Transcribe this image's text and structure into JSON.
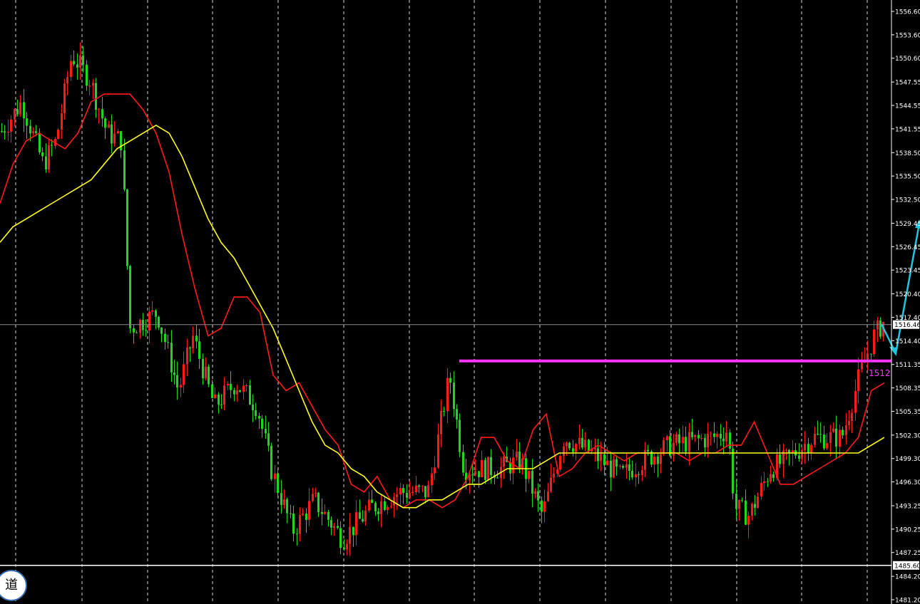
{
  "chart_data": {
    "type": "candlestick",
    "title": "",
    "y_axis": {
      "ticks": [
        "1556.60",
        "1553.60",
        "1550.60",
        "1547.55",
        "1544.55",
        "1541.55",
        "1538.50",
        "1535.50",
        "1532.50",
        "1529.45",
        "1526.45",
        "1523.45",
        "1520.40",
        "1517.40",
        "1514.40",
        "1511.35",
        "1508.35",
        "1505.35",
        "1502.30",
        "1499.30",
        "1496.30",
        "1493.25",
        "1490.25",
        "1487.25",
        "1484.20",
        "1481.20"
      ],
      "ylim": [
        1481.2,
        1557.7
      ],
      "position": "right"
    },
    "grid": {
      "vertical_dashed": true,
      "horizontal": false
    },
    "current_price": "1516.46",
    "support_line": {
      "value": 1485.6,
      "label": "1485.60"
    },
    "resistance_line": {
      "value": 1511.8,
      "label": "1512",
      "color": "#ff33ff"
    },
    "projection_arrow_color": "#22c5e0",
    "candle_colors": {
      "up": "#ff1a1a",
      "down": "#1fd61f"
    },
    "series": [
      {
        "type": "line",
        "color": "#ff1a1a",
        "values": [
          1532,
          1537,
          1540,
          1541,
          1540,
          1539,
          1541,
          1545,
          1546,
          1546,
          1546,
          1544,
          1541,
          1536,
          1528,
          1521,
          1515,
          1516,
          1520,
          1520,
          1518,
          1510,
          1508,
          1509,
          1506,
          1503,
          1501,
          1496,
          1495,
          1497,
          1494,
          1493,
          1494,
          1494,
          1493,
          1494,
          1497,
          1502,
          1502,
          1499,
          1498,
          1503,
          1505,
          1497,
          1498,
          1500,
          1501,
          1500,
          1499,
          1500,
          1500,
          1500,
          1500,
          1499,
          1500,
          1500,
          1501,
          1501,
          1504,
          1500,
          1496,
          1496,
          1497,
          1498,
          1499,
          1500,
          1502,
          1508,
          1509
        ]
      },
      {
        "type": "line",
        "color": "#ffff1f",
        "values": [
          1527,
          1529,
          1530,
          1531,
          1532,
          1533,
          1534,
          1535,
          1537,
          1539,
          1540,
          1541,
          1542,
          1541,
          1538,
          1534,
          1530,
          1527,
          1525,
          1522,
          1519,
          1516,
          1512,
          1508,
          1504,
          1501,
          1500,
          1498,
          1497,
          1495,
          1494,
          1493,
          1493,
          1494,
          1494,
          1495,
          1496,
          1496,
          1497,
          1498,
          1498,
          1498,
          1499,
          1500,
          1500,
          1500,
          1500,
          1500,
          1500,
          1500,
          1500,
          1500,
          1500,
          1500,
          1500,
          1500,
          1500,
          1500,
          1500,
          1500,
          1500,
          1500,
          1500,
          1500,
          1500,
          1500,
          1500,
          1501,
          1502
        ]
      }
    ]
  },
  "logo": {
    "text": "道"
  }
}
